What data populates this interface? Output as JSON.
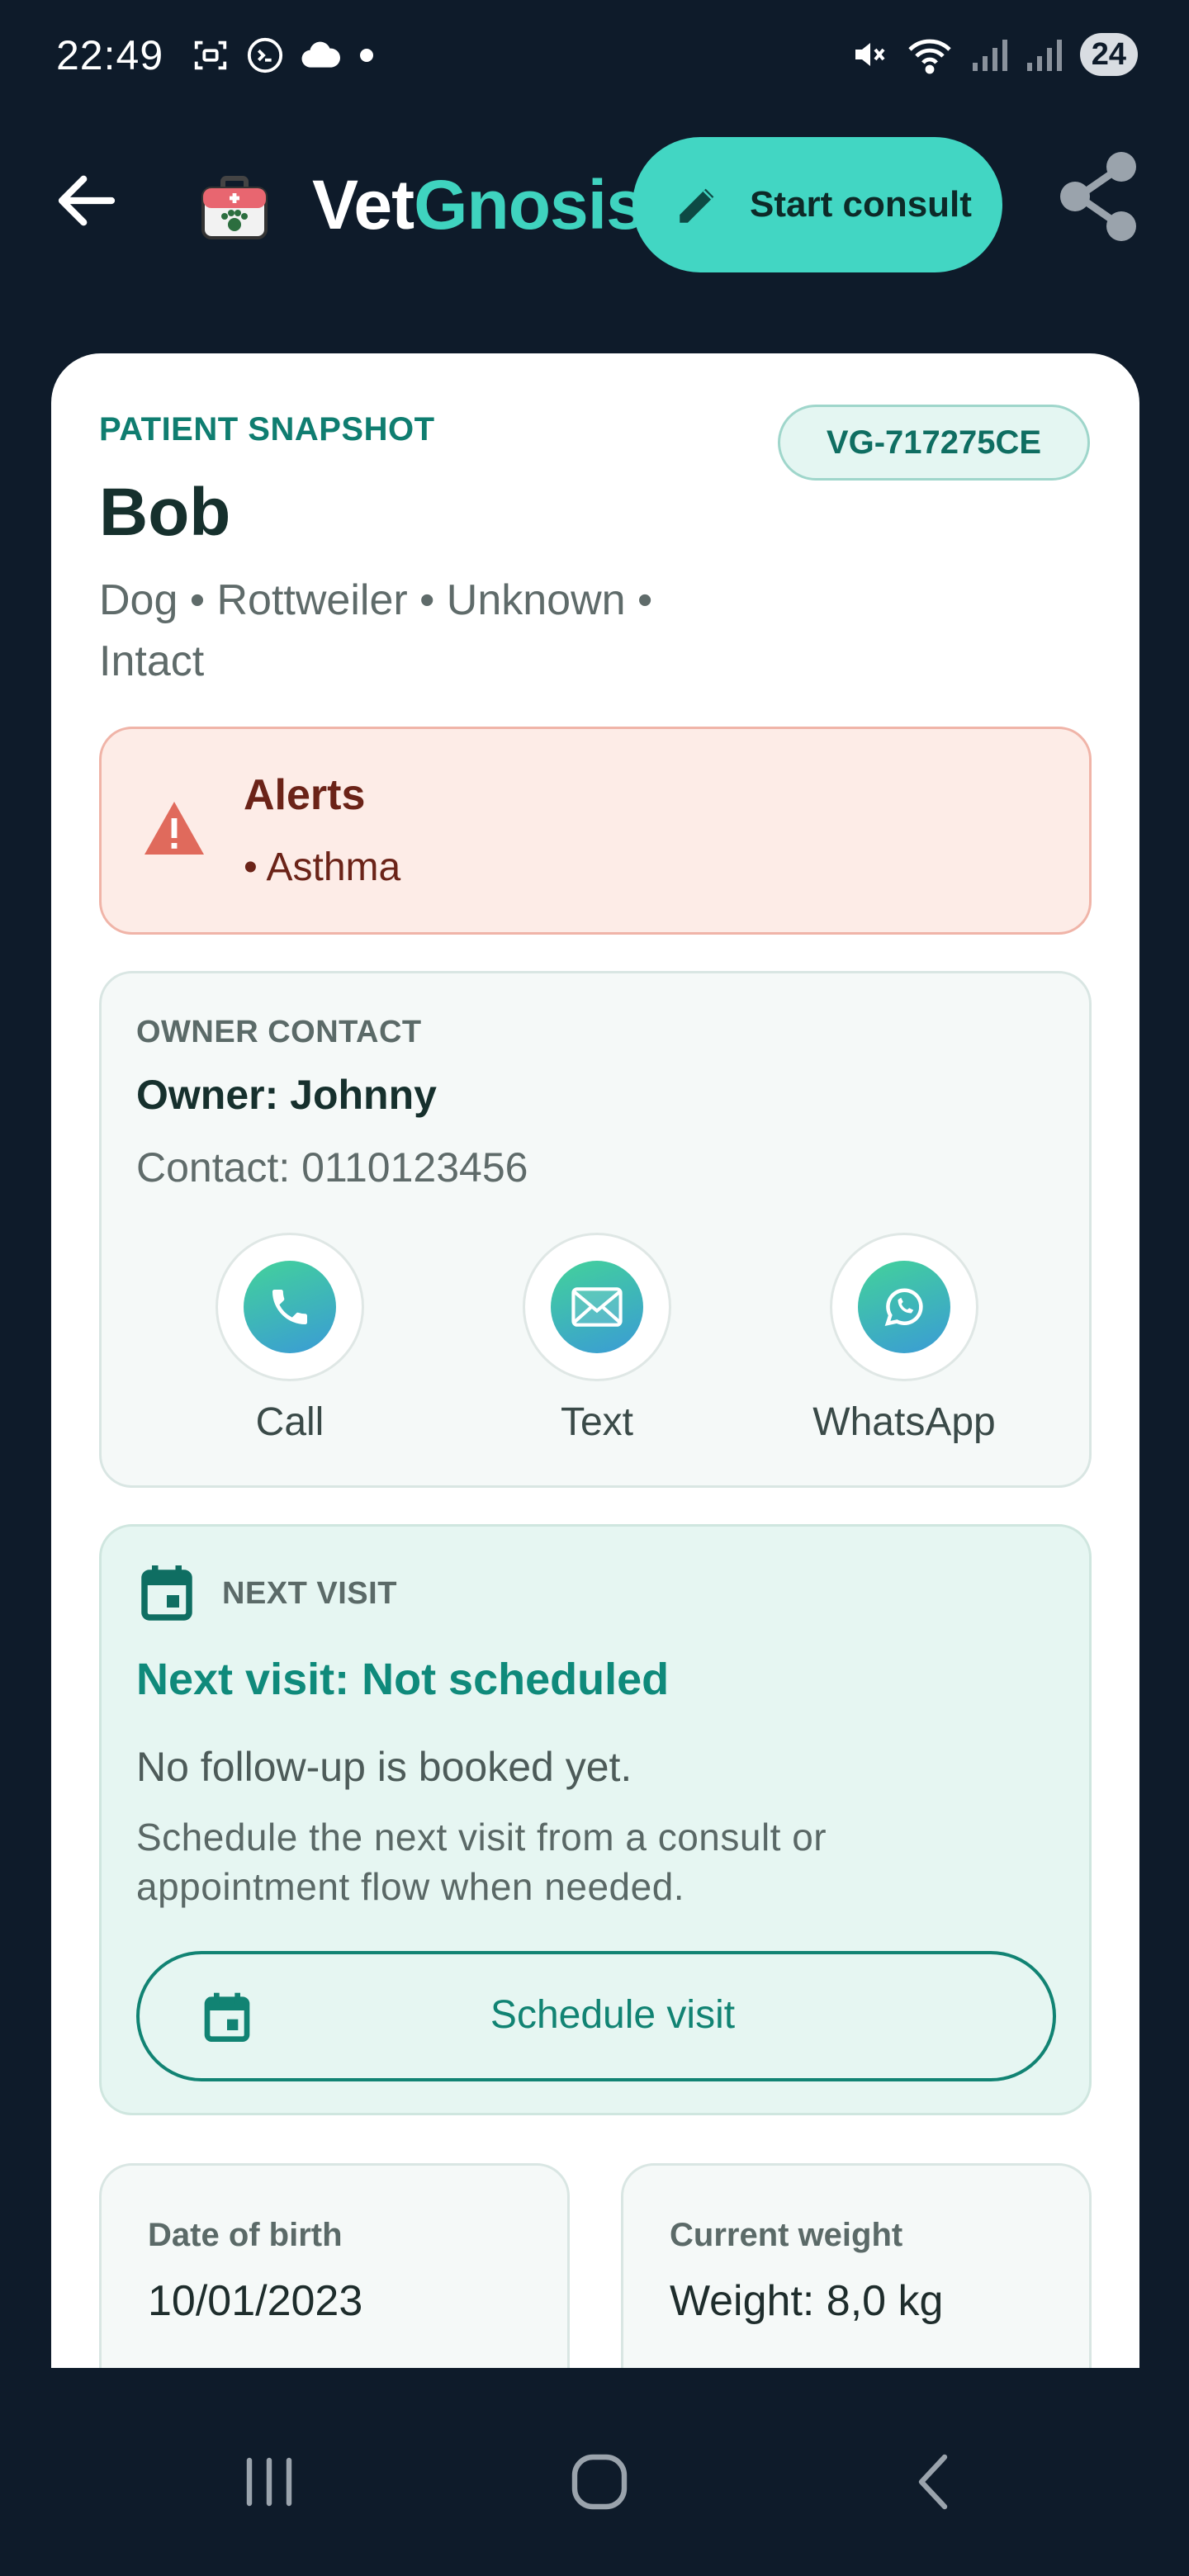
{
  "status_bar": {
    "time": "22:49",
    "battery": "24",
    "icons_left": [
      "screenshot-icon",
      "terminal-icon",
      "cloud-icon",
      "dot-icon"
    ],
    "icons_right": [
      "mute-icon",
      "wifi-icon",
      "signal-icon",
      "signal-icon"
    ]
  },
  "app_bar": {
    "title_part1": "Vet",
    "title_part2": "Gnosis",
    "start_consult_label": "Start consult",
    "accent_color": "#42d6c3"
  },
  "patient": {
    "section_label": "PATIENT SNAPSHOT",
    "id": "VG-717275CE",
    "name": "Bob",
    "details": "Dog • Rottweiler • Unknown • Intact"
  },
  "alerts": {
    "title": "Alerts",
    "items": [
      "• Asthma"
    ]
  },
  "owner": {
    "section_label": "OWNER CONTACT",
    "name": "Owner: Johnny",
    "contact": "Contact: 0110123456",
    "actions": [
      {
        "label": "Call",
        "icon": "phone-icon"
      },
      {
        "label": "Text",
        "icon": "envelope-icon"
      },
      {
        "label": "WhatsApp",
        "icon": "whatsapp-icon"
      }
    ]
  },
  "next_visit": {
    "section_label": "NEXT VISIT",
    "title": "Next visit: Not scheduled",
    "subtitle": "No follow-up is booked yet.",
    "hint": "Schedule the next visit from a consult or appointment flow when needed.",
    "button_label": "Schedule visit"
  },
  "tiles": {
    "dob_label": "Date of birth",
    "dob_value": "10/01/2023",
    "weight_label": "Current weight",
    "weight_value": "Weight: 8,0 kg"
  }
}
